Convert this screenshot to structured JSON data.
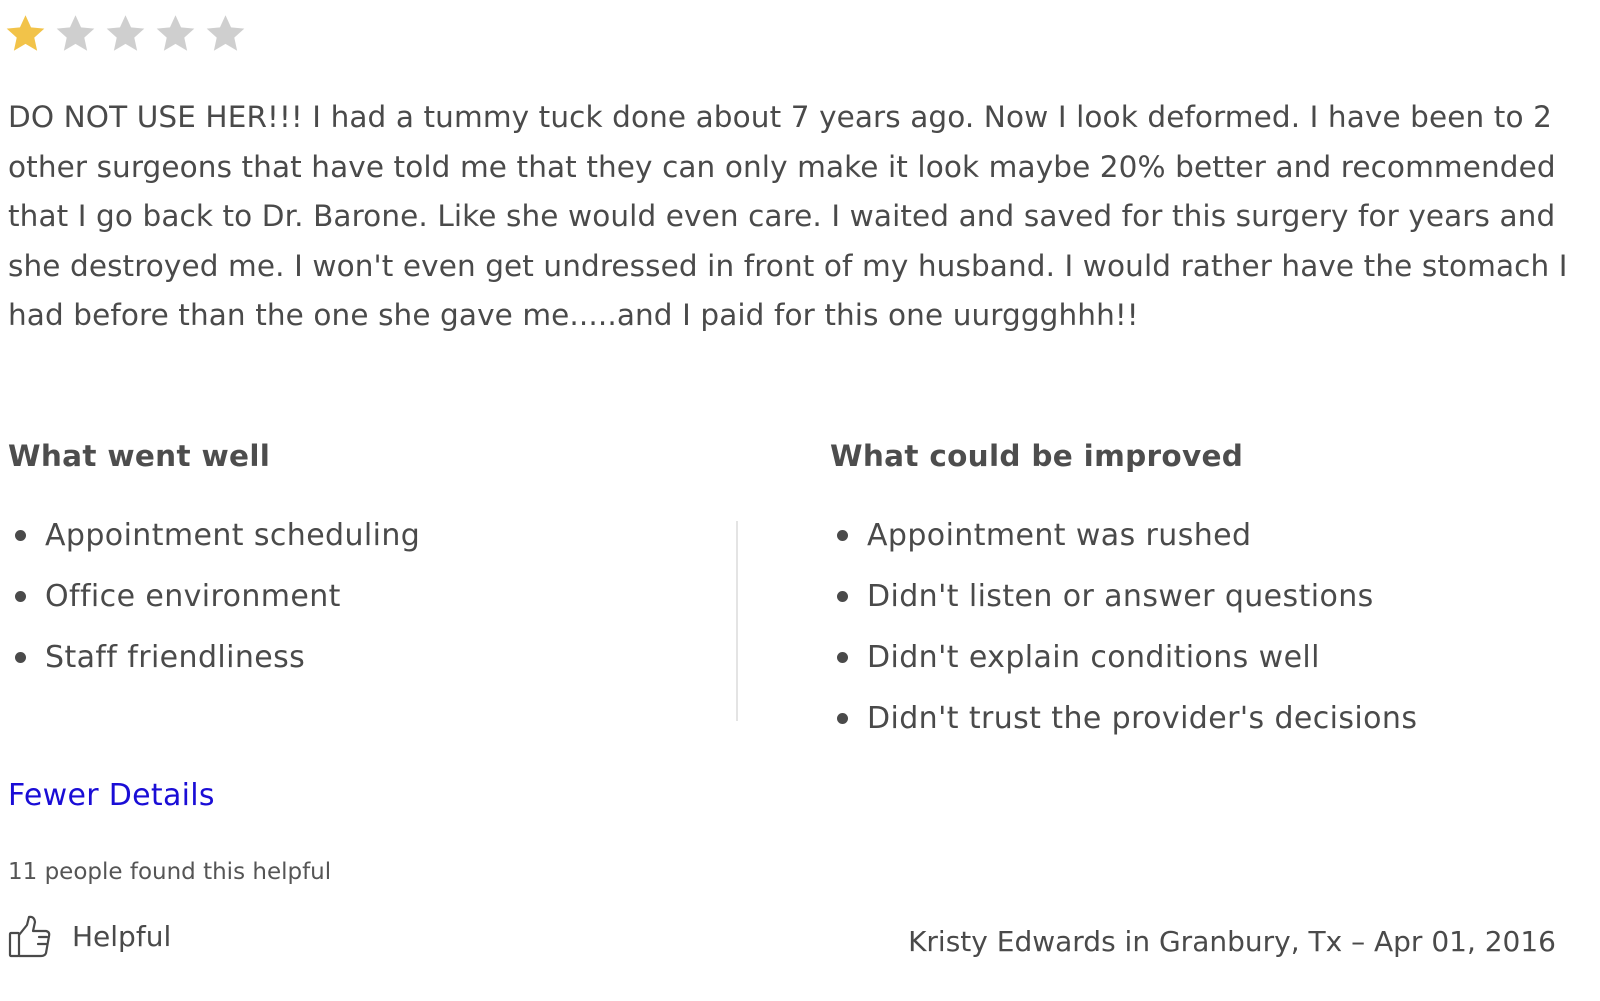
{
  "rating": {
    "value": 1,
    "max": 5,
    "filled_color": "#f2c349",
    "empty_color": "#cfcfcf"
  },
  "review": {
    "text": "DO NOT USE HER!!! I had a tummy tuck done about 7 years ago. Now I look deformed. I have been to 2 other surgeons that have told me that they can only make it look maybe 20% better and recommended that I go back to Dr. Barone. Like she would even care. I waited and saved for this surgery for years and she destroyed me. I won't even get undressed in front of my husband. I would rather have the stomach I had before than the one she gave me.....and I paid for this one uurggghhh!!"
  },
  "went_well": {
    "heading": "What went well",
    "items": [
      "Appointment scheduling",
      "Office environment",
      "Staff friendliness"
    ]
  },
  "could_improve": {
    "heading": "What could be improved",
    "items": [
      "Appointment was rushed",
      "Didn't listen or answer questions",
      "Didn't explain conditions well",
      "Didn't trust the provider's decisions"
    ]
  },
  "details_link": {
    "label": "Fewer Details",
    "color": "#1a0dd6"
  },
  "helpful": {
    "count_text": "11 people found this helpful",
    "button_label": "Helpful",
    "icon": "thumbs-up-icon"
  },
  "reviewer": {
    "line": "Kristy Edwards in Granbury, Tx – Apr 01, 2016"
  }
}
